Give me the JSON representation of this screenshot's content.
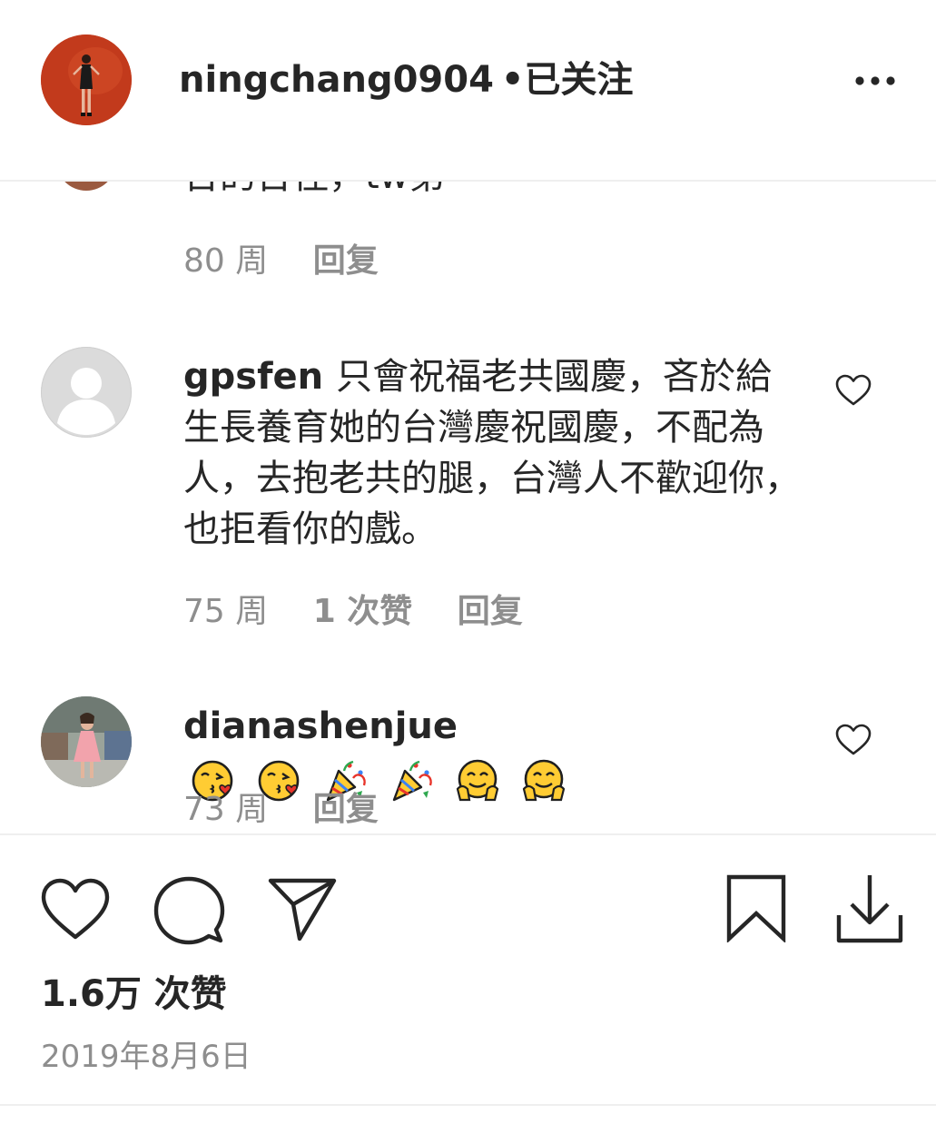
{
  "header": {
    "username": "ningchang0904",
    "separator": "•",
    "follow_status": "已关注",
    "avatar_icon": "profile-photo-red-background",
    "more_icon": "more-horizontal-icon"
  },
  "comments": [
    {
      "text_partial": "台的台住，tw第",
      "time": "80 周",
      "reply_label": "回复"
    },
    {
      "username": "gpsfen",
      "text": "只會祝福老共國慶，吝於給生長養育她的台灣慶祝國慶，不配為人，去抱老共的腿，台灣人不歡迎你，也拒看你的戲。",
      "time": "75 周",
      "likes_label": "1 次赞",
      "reply_label": "回复",
      "avatar_icon": "default-avatar-icon"
    },
    {
      "username": "dianashenjue",
      "emojis": [
        "face-blowing-kiss",
        "face-blowing-kiss",
        "party-popper",
        "party-popper",
        "hugging-face",
        "hugging-face"
      ],
      "time": "73 周",
      "reply_label": "回复",
      "avatar_icon": "profile-photo-pink-dress"
    }
  ],
  "actions": {
    "like_icon": "heart-icon",
    "comment_icon": "comment-icon",
    "share_icon": "send-icon",
    "save_icon": "bookmark-icon",
    "download_icon": "download-icon"
  },
  "post": {
    "likes_count": "1.6万 次赞",
    "date": "2019年8月6日"
  },
  "colors": {
    "text_primary": "#262626",
    "text_secondary": "#8e8e8e",
    "divider": "#efefef"
  }
}
